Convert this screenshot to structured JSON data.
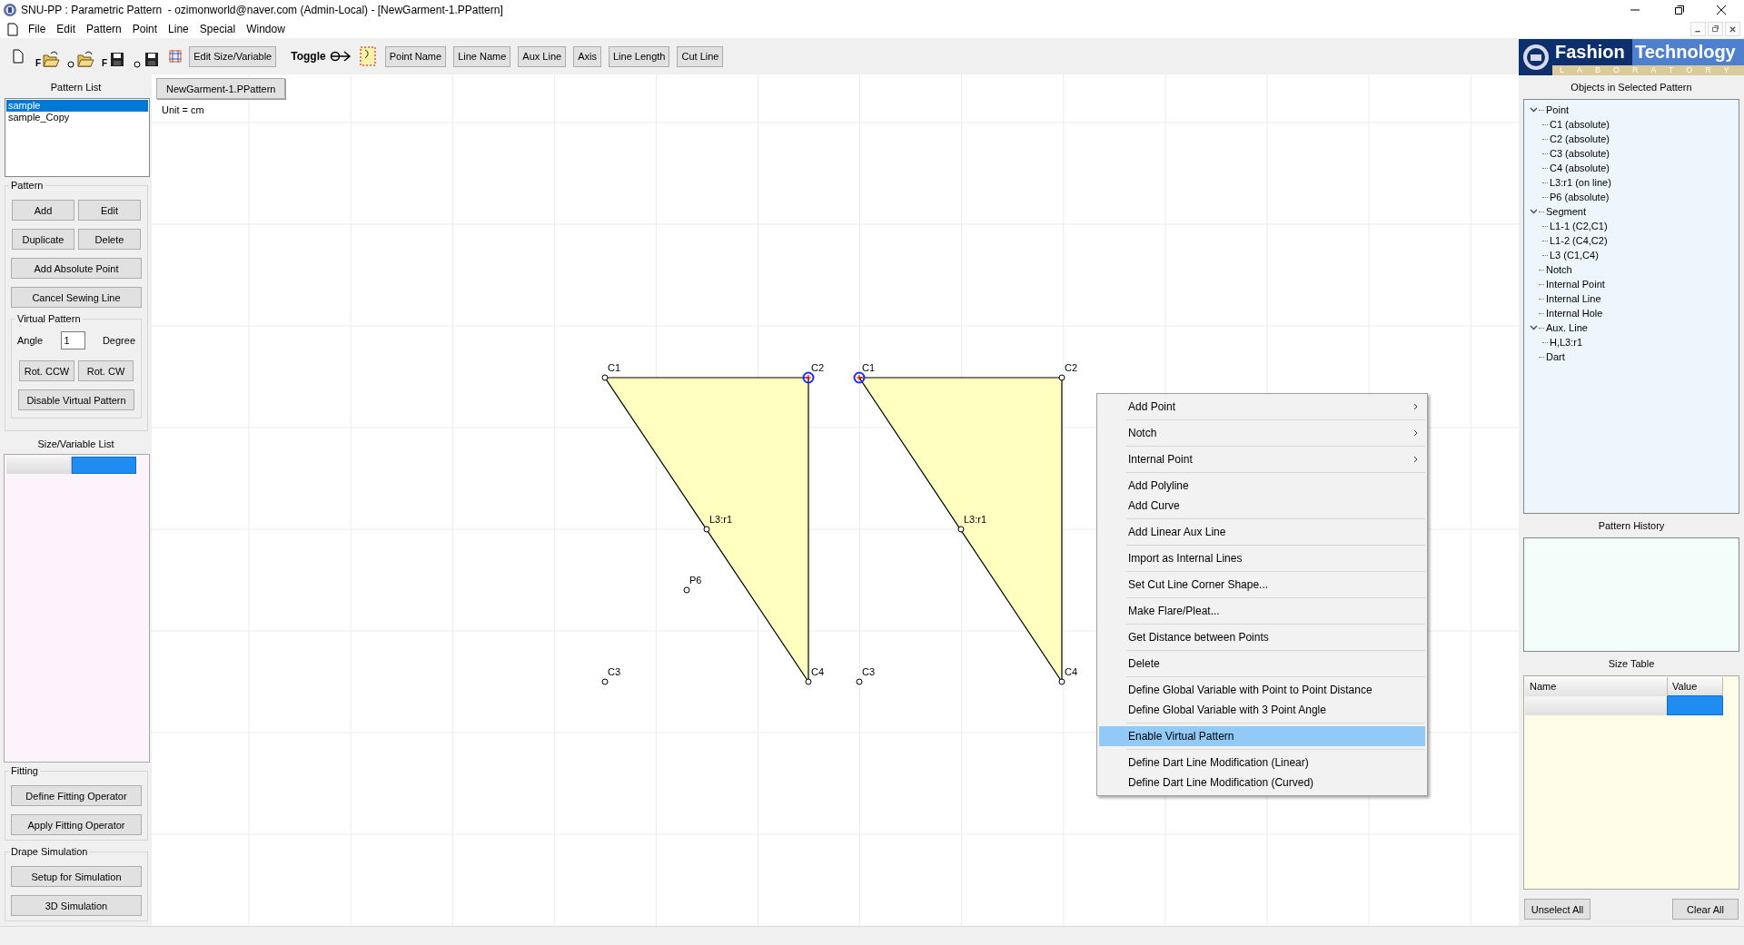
{
  "window": {
    "title": "SNU-PP : Parametric Pattern  - ozimonworld@naver.com (Admin-Local) - [NewGarment-1.PPattern]"
  },
  "menu_bar": [
    "File",
    "Edit",
    "Pattern",
    "Point",
    "Line",
    "Special",
    "Window"
  ],
  "toolbar": [
    {
      "kind": "new"
    },
    {
      "kind": "open",
      "badge": "F"
    },
    {
      "kind": "open",
      "ring": true
    },
    {
      "kind": "save",
      "badge": "F"
    },
    {
      "kind": "save",
      "ring": true
    },
    {
      "kind": "grid"
    },
    {
      "kind": "button",
      "label": "Edit Size/Variable"
    },
    {
      "kind": "label",
      "label": "Toggle"
    },
    {
      "kind": "toggle"
    },
    {
      "kind": "region"
    },
    {
      "kind": "button",
      "label": "Point Name"
    },
    {
      "kind": "button",
      "label": "Line Name"
    },
    {
      "kind": "button",
      "label": "Aux Line"
    },
    {
      "kind": "button",
      "label": "Axis"
    },
    {
      "kind": "button",
      "label": "Line Length"
    },
    {
      "kind": "button",
      "label": "Cut Line"
    }
  ],
  "left_panel": {
    "pattern_list": {
      "title": "Pattern List",
      "items": [
        {
          "label": "sample",
          "selected": true
        },
        {
          "label": "sample_Copy",
          "selected": false
        }
      ]
    },
    "pattern_group": {
      "legend": "Pattern",
      "buttons": [
        "Add",
        "Edit",
        "Duplicate",
        "Delete",
        "Add Absolute Point",
        "Cancel Sewing Line"
      ]
    },
    "virtual_pattern": {
      "legend": "Virtual Pattern",
      "angle_label": "Angle",
      "angle_value": "1",
      "unit": "Degree",
      "buttons": [
        "Rot. CCW",
        "Rot. CW",
        "Disable Virtual Pattern"
      ]
    },
    "size_variable_list": {
      "title": "Size/Variable List",
      "columns": [
        {
          "selected": false
        },
        {
          "selected": true
        }
      ]
    },
    "fitting": {
      "legend": "Fitting",
      "buttons": [
        "Define Fitting Operator",
        "Apply Fitting Operator"
      ]
    },
    "drape": {
      "legend": "Drape Simulation",
      "buttons": [
        "Setup for Simulation",
        "3D Simulation"
      ]
    }
  },
  "canvas": {
    "tab": "NewGarment-1.PPattern",
    "unit": "Unit = cm",
    "patterns": [
      {
        "points": [
          {
            "label": "C1",
            "selected": false
          },
          {
            "label": "C2",
            "selected": true
          },
          {
            "label": "L3:r1",
            "selected": false
          },
          {
            "label": "P6",
            "selected": false
          },
          {
            "label": "C3",
            "selected": false
          },
          {
            "label": "C4",
            "selected": false
          }
        ]
      },
      {
        "points": [
          {
            "label": "C1",
            "selected": true
          },
          {
            "label": "C2",
            "selected": false
          },
          {
            "label": "L3:r1",
            "selected": false
          },
          {
            "label": "C3",
            "selected": false
          },
          {
            "label": "C4",
            "selected": false
          }
        ]
      }
    ]
  },
  "context_menu": {
    "groups": [
      [
        {
          "label": "Add Point",
          "submenu": true,
          "selected": false
        }
      ],
      [
        {
          "label": "Notch",
          "submenu": true,
          "selected": false
        }
      ],
      [
        {
          "label": "Internal Point",
          "submenu": true,
          "selected": false
        }
      ],
      [
        {
          "label": "Add Polyline",
          "selected": false
        },
        {
          "label": "Add Curve",
          "selected": false
        }
      ],
      [
        {
          "label": "Add Linear Aux Line",
          "selected": false
        }
      ],
      [
        {
          "label": "Import as Internal Lines",
          "selected": false
        }
      ],
      [
        {
          "label": "Set Cut Line Corner Shape...",
          "selected": false
        }
      ],
      [
        {
          "label": "Make Flare/Pleat...",
          "selected": false
        }
      ],
      [
        {
          "label": "Get Distance between Points",
          "selected": false
        }
      ],
      [
        {
          "label": "Delete",
          "selected": false
        }
      ],
      [
        {
          "label": "Define Global Variable with Point to Point Distance",
          "selected": false
        },
        {
          "label": "Define Global Variable with 3 Point Angle",
          "selected": false
        }
      ],
      [
        {
          "label": "Enable Virtual Pattern",
          "selected": true
        }
      ],
      [
        {
          "label": "Define Dart Line Modification (Linear)",
          "selected": false
        },
        {
          "label": "Define Dart Line Modification (Curved)",
          "selected": false
        }
      ]
    ]
  },
  "right_panel": {
    "logo": {
      "word1": "Fashion",
      "word2": "Technology",
      "subtitle": "LABORATORY"
    },
    "objects": {
      "title": "Objects in Selected Pattern",
      "tree": [
        {
          "label": "Point",
          "expanded": true,
          "children": [
            {
              "label": "C1 (absolute)"
            },
            {
              "label": "C2 (absolute)"
            },
            {
              "label": "C3 (absolute)"
            },
            {
              "label": "C4 (absolute)"
            },
            {
              "label": "L3:r1 (on line)"
            },
            {
              "label": "P6 (absolute)"
            }
          ]
        },
        {
          "label": "Segment",
          "expanded": true,
          "children": [
            {
              "label": "L1-1 (C2,C1)"
            },
            {
              "label": "L1-2 (C4,C2)"
            },
            {
              "label": "L3 (C1,C4)"
            }
          ]
        },
        {
          "label": "Notch"
        },
        {
          "label": "Internal Point"
        },
        {
          "label": "Internal Line"
        },
        {
          "label": "Internal Hole"
        },
        {
          "label": "Aux. Line",
          "expanded": true,
          "children": [
            {
              "label": "H,L3:r1"
            }
          ]
        },
        {
          "label": "Dart"
        }
      ]
    },
    "history": {
      "title": "Pattern History"
    },
    "size_table": {
      "title": "Size Table",
      "columns": [
        "Name",
        "Value"
      ],
      "rows": [
        {
          "cells": [
            {
              "selected": false
            },
            {
              "selected": true
            }
          ]
        }
      ]
    },
    "buttons": [
      "Unselect All",
      "Clear All"
    ]
  }
}
